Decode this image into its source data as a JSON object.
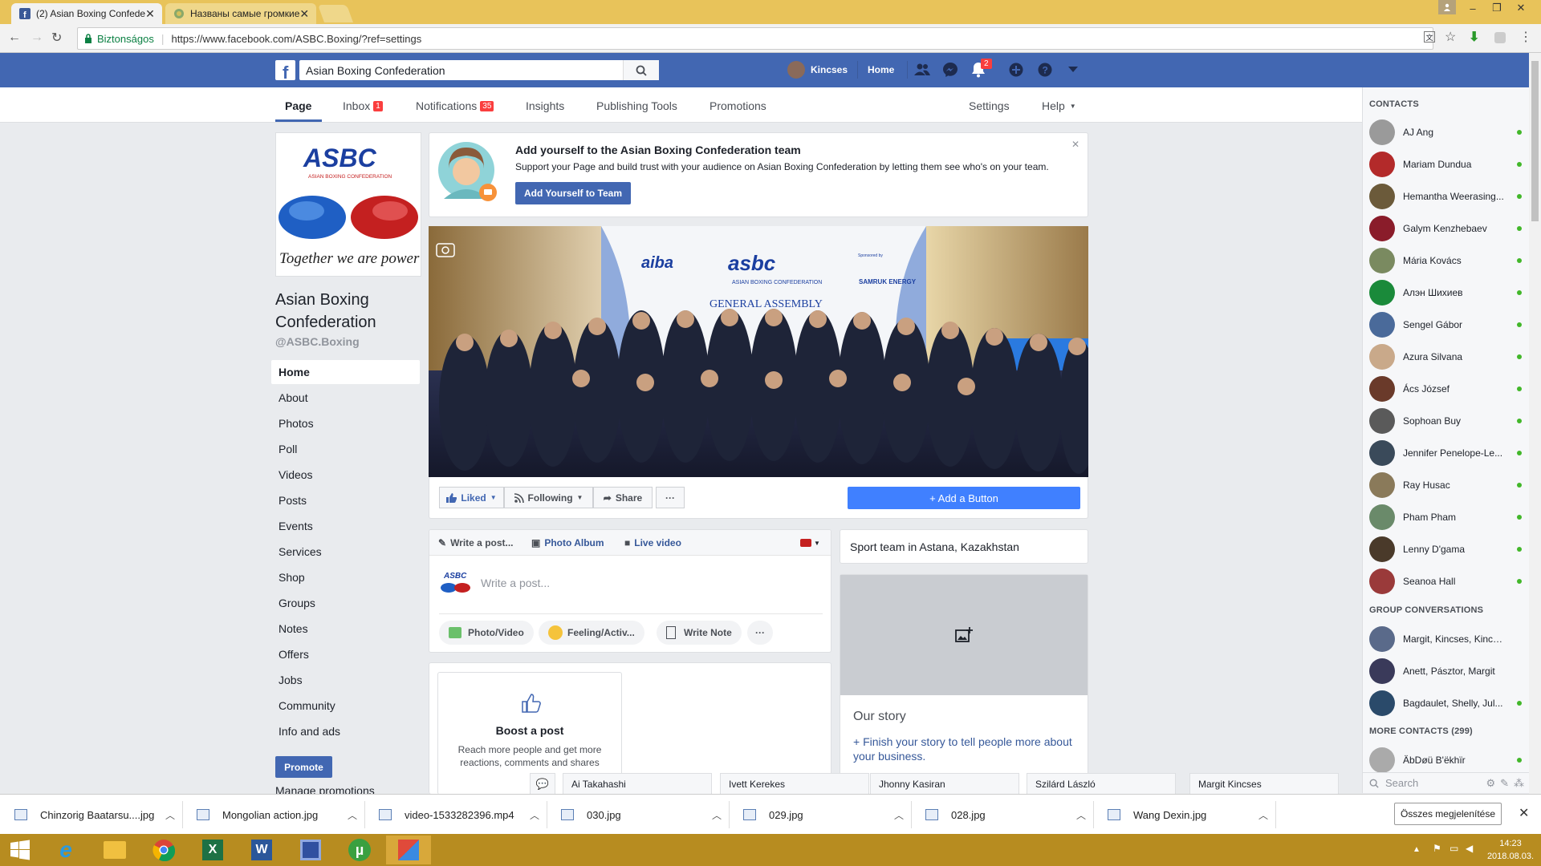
{
  "browser": {
    "tabs": [
      {
        "title": "(2) Asian Boxing Confede",
        "active": true
      },
      {
        "title": "Названы самые громкие",
        "active": false
      }
    ],
    "secure_label": "Biztonságos",
    "url": "https://www.facebook.com/ASBC.Boxing/?ref=settings"
  },
  "fb_header": {
    "search_value": "Asian Boxing Confederation",
    "user_name": "Kincses",
    "home_label": "Home",
    "notification_count": "2"
  },
  "page_nav": {
    "items": [
      {
        "label": "Page"
      },
      {
        "label": "Inbox",
        "badge": "1"
      },
      {
        "label": "Notifications",
        "badge": "35"
      },
      {
        "label": "Insights"
      },
      {
        "label": "Publishing Tools"
      },
      {
        "label": "Promotions"
      }
    ],
    "settings": "Settings",
    "help": "Help"
  },
  "left": {
    "logo_text": "ASBC",
    "logo_subtitle": "ASIAN BOXING CONFEDERATION",
    "logo_slogan": "Together we are power",
    "page_name": "Asian Boxing Confederation",
    "handle": "@ASBC.Boxing",
    "nav": [
      "Home",
      "About",
      "Photos",
      "Poll",
      "Videos",
      "Posts",
      "Events",
      "Services",
      "Shop",
      "Groups",
      "Notes",
      "Offers",
      "Jobs",
      "Community",
      "Info and ads"
    ],
    "promote": "Promote",
    "manage_promotions": "Manage promotions"
  },
  "team_card": {
    "title": "Add yourself to the Asian Boxing Confederation team",
    "body": "Support your Page and build trust with your audience on Asian Boxing Confederation by letting them see who's on your team.",
    "button": "Add Yourself to Team"
  },
  "cover": {
    "logo_aiba": "aiba",
    "logo_asbc": "asbc",
    "org_text": "ASIAN BOXING CONFEDERATION",
    "banner": "GENERAL ASSEMBLY",
    "sponsor_caption": "Sponsored by",
    "sponsor": "SAMRUK ENERGY"
  },
  "actions": {
    "liked": "Liked",
    "following": "Following",
    "share": "Share",
    "more": "···",
    "add_button": "+ Add a Button"
  },
  "composer": {
    "tabs": [
      "Write a post...",
      "Photo Album",
      "Live video"
    ],
    "placeholder": "Write a post...",
    "pills": [
      "Photo/Video",
      "Feeling/Activ...",
      "Write Note"
    ],
    "more": "···"
  },
  "boost": {
    "title": "Boost a post",
    "body": "Reach more people and get more reactions, comments and shares"
  },
  "about_card": {
    "category": "Sport team in Astana, Kazakhstan"
  },
  "story": {
    "title": "Our story",
    "link": "+ Finish your story to tell people more about your business."
  },
  "contacts": {
    "header": "CONTACTS",
    "people": [
      {
        "name": "AJ Ang",
        "color": "#9a9a9a"
      },
      {
        "name": "Mariam Dundua",
        "color": "#b32a2a"
      },
      {
        "name": "Hemantha Weerasing...",
        "color": "#6b5a3a"
      },
      {
        "name": "Galym Kenzhebaev",
        "color": "#8a1c2a"
      },
      {
        "name": "Mária Kovács",
        "color": "#7a8a60"
      },
      {
        "name": "Алэн Шихиев",
        "color": "#1a8a3a"
      },
      {
        "name": "Sengel Gábor",
        "color": "#4a6a9a"
      },
      {
        "name": "Azura Silvana",
        "color": "#c9a98a"
      },
      {
        "name": "Ács József",
        "color": "#6a3a2a"
      },
      {
        "name": "Sophoan Buy",
        "color": "#5a5a5a"
      },
      {
        "name": "Jennifer Penelope-Le...",
        "color": "#3a4a5a"
      },
      {
        "name": "Ray Husac",
        "color": "#8a7a5a"
      },
      {
        "name": "Pham Pham",
        "color": "#6a8a6a"
      },
      {
        "name": "Lenny D'gama",
        "color": "#4a3a2a"
      },
      {
        "name": "Seanoa Hall",
        "color": "#9a3a3a"
      }
    ],
    "group_header": "GROUP CONVERSATIONS",
    "groups": [
      {
        "name": "Margit, Kincses, Kincses",
        "color": "#5a6a8a",
        "online": false
      },
      {
        "name": "Anett, Pásztor, Margit",
        "color": "#3a3a5a",
        "online": false
      },
      {
        "name": "Bagdaulet, Shelly, Jul...",
        "color": "#2a4a6a",
        "online": true
      }
    ],
    "more_header": "MORE CONTACTS (299)",
    "more": [
      {
        "name": "ÄbDøü B'ëkhïr",
        "color": "#aaaaaa"
      }
    ],
    "search_placeholder": "Search"
  },
  "chat_tabs": [
    "Ai Takahashi",
    "Ivett Kerekes",
    "Jhonny Kasiran",
    "Szilárd László",
    "Margit Kincses"
  ],
  "downloads": {
    "items": [
      "Chinzorig Baatarsu....jpg",
      "Mongolian action.jpg",
      "video-1533282396.mp4",
      "030.jpg",
      "029.jpg",
      "028.jpg",
      "Wang Dexin.jpg"
    ],
    "show_all": "Összes megjelenítése"
  },
  "taskbar": {
    "time": "14:23",
    "date": "2018.08.03."
  },
  "colors": {
    "fb_blue": "#4267b2",
    "online": "#42b72a",
    "badge": "#fa3e3e",
    "link": "#365899"
  }
}
